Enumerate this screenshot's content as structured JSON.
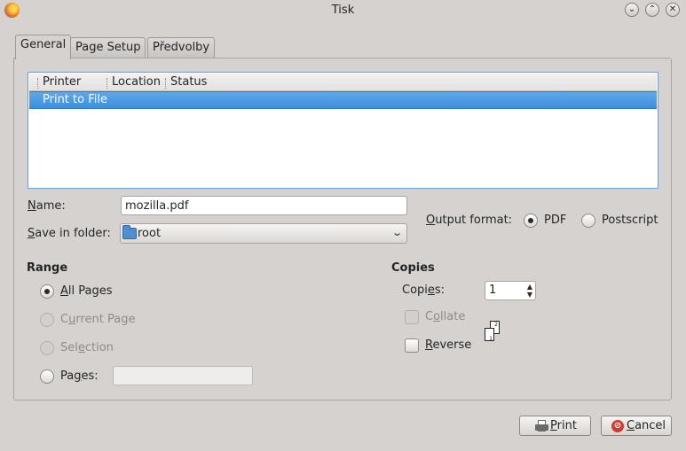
{
  "window": {
    "title": "Tisk",
    "controls": {
      "minimize": "⌄",
      "maximize": "⌃",
      "close": "✕"
    }
  },
  "tabs": [
    {
      "label": "General",
      "active": true
    },
    {
      "label": "Page Setup",
      "active": false
    },
    {
      "label": "Předvolby",
      "active": false
    }
  ],
  "printers": {
    "columns": [
      "Printer",
      "Location",
      "Status"
    ],
    "rows": [
      {
        "printer": "Print to File",
        "location": "",
        "status": "",
        "selected": true
      }
    ]
  },
  "file": {
    "name_label_u": "N",
    "name_label_rest": "ame:",
    "name_value": "mozilla.pdf",
    "folder_label_u": "S",
    "folder_label_rest": "ave in folder:",
    "folder_value": "root",
    "output_format_label_u": "O",
    "output_format_label_rest": "utput format:",
    "formats": [
      {
        "label": "PDF",
        "checked": true
      },
      {
        "label": "Postscript",
        "checked": false
      }
    ]
  },
  "range": {
    "title": "Range",
    "all_pages_u": "A",
    "all_pages_rest": "ll Pages",
    "current_page_pre": "C",
    "current_page_u": "u",
    "current_page_rest": "rrent Page",
    "selection_pre": "Sel",
    "selection_u": "e",
    "selection_rest": "ction",
    "pages_pre": "Pa",
    "pages_u": "g",
    "pages_rest": "es:",
    "pages_value": ""
  },
  "copies": {
    "title": "Copies",
    "copies_label_pre": "Copi",
    "copies_label_u": "e",
    "copies_label_rest": "s:",
    "copies_value": "1",
    "collate_pre": "C",
    "collate_u": "o",
    "collate_rest": "llate",
    "reverse_u": "R",
    "reverse_rest": "everse",
    "page_one": "1",
    "page_two": "2"
  },
  "buttons": {
    "print_u": "P",
    "print_rest": "rint",
    "cancel_u": "C",
    "cancel_rest": "ancel"
  },
  "colors": {
    "selection": "#3d8fdc",
    "window_bg": "#d6d2d0",
    "focus_border": "#6ca3d6"
  }
}
